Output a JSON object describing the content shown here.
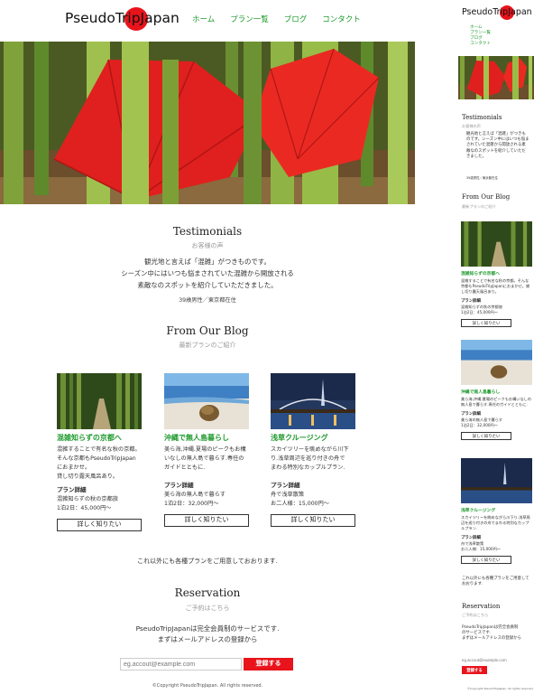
{
  "brand": {
    "logo_text": "PseudoTripJapan",
    "accent_color": "#e8131b",
    "link_color": "#1e9a2c"
  },
  "nav": {
    "items": [
      {
        "label": "ホーム"
      },
      {
        "label": "プラン一覧"
      },
      {
        "label": "ブログ"
      },
      {
        "label": "コンタクト"
      }
    ]
  },
  "hero": {
    "image": "red-umbrellas-bamboo-forest"
  },
  "testimonials": {
    "title": "Testimonials",
    "subtitle": "お客様の声",
    "body_lines": [
      "観光地と言えば「混雑」がつきものです。",
      "シーズン中にはいつも悩まされていた混雑から開放される",
      "素敵なのスポットを紹介していただきました。"
    ],
    "mobile_body": "観光地と言えば「混雑」がつきものです。シーズン中にはいつも悩まされていた混雑から開放される素敵なのスポットを紹介していただきました。",
    "author": "39歳男性／東京都在住"
  },
  "blog": {
    "title": "From Our Blog",
    "subtitle": "最新プランのご紹介",
    "cards": [
      {
        "image": "bamboo-path-photo",
        "title": "混雑知らずの京都へ",
        "desc_lines": [
          "混雑することで有名な秋の京都。",
          "そんな京都もPseudoTripJapan",
          "におまかせ。",
          "貸し切り露天風呂あり。"
        ],
        "mobile_desc": "混雑することで有名な秋の京都。そんな京都もPseudoTripJapanにおまかせ。貸し切り露天風呂あり。",
        "plan_label": "プラン詳細",
        "detail_lines": [
          "混雑知らずの秋の京都旅",
          "1泊2日：45,000円〜"
        ],
        "button": "詳しく知りたい"
      },
      {
        "image": "coconut-beach-photo",
        "title": "沖縄で無人島暮らし",
        "desc_lines": [
          "美ら海,沖縄.夏場のピークもお構",
          "いなしの無人島で暮らす.専任の",
          "ガイドとともに."
        ],
        "mobile_desc": "美ら海,沖縄.夏場のピークもお構いなしの無人島で暮らす.専任のガイドとともに.",
        "plan_label": "プラン詳細",
        "detail_lines": [
          "美ら海の無人島で暮らす",
          "1泊2日：32,000円〜"
        ],
        "button": "詳しく知りたい"
      },
      {
        "image": "skytree-night-photo",
        "title": "浅草クルージング",
        "desc_lines": [
          "スカイツリーを眺めながら川下",
          "り.浅草周辺を巡り付きの舟で",
          "まわる特別なカップルプラン."
        ],
        "mobile_desc": "スカイツリーを眺めながら川下り.浅草周辺を巡り付きの舟でまわる特別なカップルプラン.",
        "plan_label": "プラン詳細",
        "detail_lines": [
          "舟で浅草散策",
          "お二人様：15,000円〜"
        ],
        "button": "詳しく知りたい"
      }
    ]
  },
  "others_text": "これ以外にも各種プランをご用意しておおります.",
  "reservation": {
    "title": "Reservation",
    "subtitle": "ご予約はこちら",
    "body_lines": [
      "PseudoTripJapanは完全会員制のサービスです.",
      "まずはメールアドレスの登録から"
    ],
    "mobile_body_lines": [
      "PseudoTripJapanは完全会員制",
      "のサービスです.",
      "まずはメールアドレスの登録から"
    ],
    "email_placeholder": "eg.accout@example.com",
    "submit": "登録する"
  },
  "footer": {
    "copyright": "©Copyright PseudoTripJapan. All rights reserved."
  }
}
